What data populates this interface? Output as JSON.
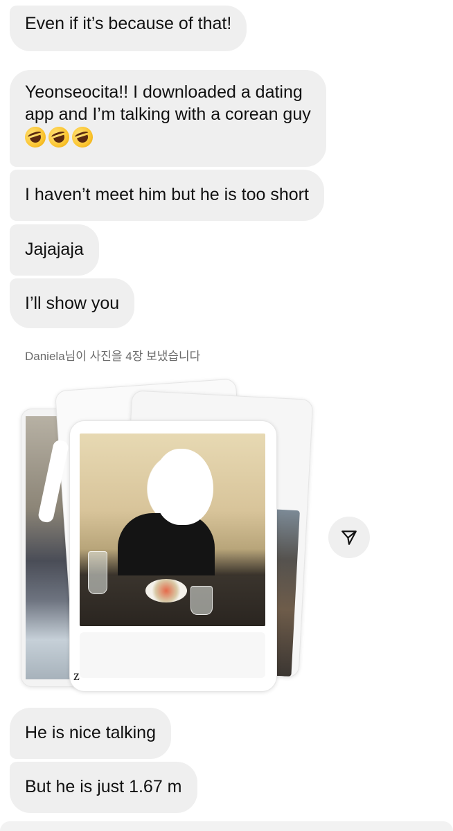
{
  "messages_top": [
    {
      "text": "Even if it’s because of that!"
    },
    {
      "line1": "Yeonseocita!! I downloaded a dating",
      "line2": "app and I’m talking with a corean guy",
      "emoji": [
        "rofl",
        "rofl",
        "rofl"
      ]
    },
    {
      "text": "I haven’t meet him but he is too short"
    },
    {
      "text": "Jajajaja"
    },
    {
      "text": "I’ll show you"
    }
  ],
  "system_note": "Daniela님이 사진을 4장 보냈습니다",
  "photo_stack": {
    "count": 4,
    "caption_letter": "z"
  },
  "share_button": {
    "icon": "send-icon"
  },
  "messages_bottom": [
    {
      "text": "He is nice talking"
    },
    {
      "text": "But he is just 1.67 m"
    }
  ],
  "colors": {
    "bubble": "#efefef",
    "text": "#111111",
    "system_text": "#6b6b6b"
  }
}
